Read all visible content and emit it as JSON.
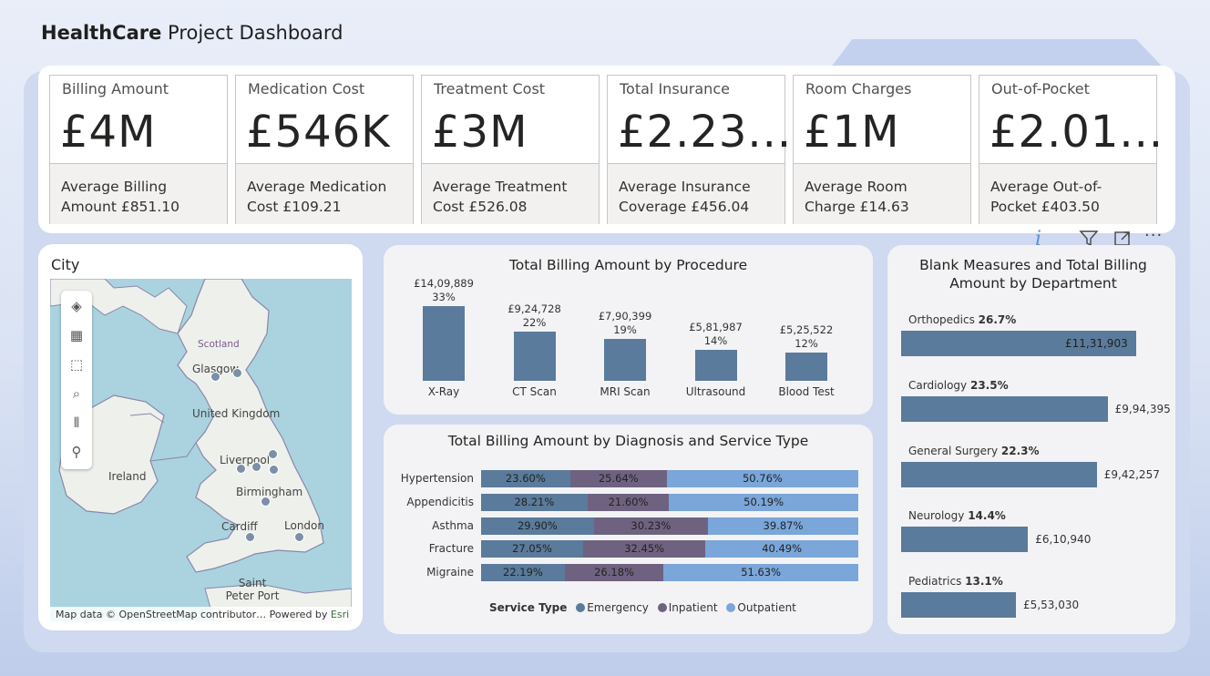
{
  "title": {
    "bold": "HealthCare",
    "rest": " Project Dashboard"
  },
  "kpis": [
    {
      "label": "Billing Amount",
      "value": "£4M",
      "foot": "Average Billing Amount £851.10"
    },
    {
      "label": "Medication Cost",
      "value": "£546K",
      "foot": "Average Medication Cost £109.21"
    },
    {
      "label": "Treatment Cost",
      "value": "£3M",
      "foot": "Average Treatment Cost £526.08"
    },
    {
      "label": "Total Insurance",
      "value": "£2.23...",
      "foot": "Average Insurance Coverage £456.04"
    },
    {
      "label": "Room Charges",
      "value": "£1M",
      "foot": "Average Room Charge £14.63"
    },
    {
      "label": "Out-of-Pocket",
      "value": "£2.01...",
      "foot": "Average Out-of-Pocket £403.50"
    }
  ],
  "visual_header": {
    "icons": [
      "info-icon",
      "filter-icon",
      "focus-mode-icon",
      "more-options-icon"
    ]
  },
  "map": {
    "title": "City",
    "labels": {
      "scotland": "Scotland",
      "glasgow": "Glasgow",
      "uk": "United Kingdom",
      "ireland": "Ireland",
      "liverpool": "Liverpool",
      "birmingham": "Birmingham",
      "cardiff": "Cardiff",
      "london": "London",
      "saint_peter_port": "Saint Peter Port"
    },
    "attribution": "Map data © OpenStreetMap contributor…",
    "powered_by": "Powered by ",
    "esri": "Esri",
    "tools": [
      "layers-icon",
      "qr-icon",
      "select-icon",
      "search-icon",
      "chart-icon",
      "person-icon"
    ]
  },
  "chart_data": [
    {
      "type": "bar",
      "title": "Total Billing Amount by Procedure",
      "categories": [
        "X-Ray",
        "CT Scan",
        "MRI Scan",
        "Ultrasound",
        "Blood Test"
      ],
      "values": [
        1409889,
        924728,
        790399,
        581987,
        525522
      ],
      "value_labels": [
        "£14,09,889",
        "£9,24,728",
        "£7,90,399",
        "£5,81,987",
        "£5,25,522"
      ],
      "percent_labels": [
        "33%",
        "22%",
        "19%",
        "14%",
        "12%"
      ],
      "color": "#5a7b9b"
    },
    {
      "type": "bar",
      "orientation": "horizontal-stacked-100",
      "title": "Total Billing Amount by Diagnosis and Service Type",
      "categories": [
        "Hypertension",
        "Appendicitis",
        "Asthma",
        "Fracture",
        "Migraine"
      ],
      "legend_title": "Service Type",
      "series": [
        {
          "name": "Emergency",
          "values": [
            23.6,
            28.21,
            29.9,
            27.05,
            22.19
          ],
          "labels": [
            "23.60%",
            "28.21%",
            "29.90%",
            "27.05%",
            "22.19%"
          ],
          "color": "#5a7b9b"
        },
        {
          "name": "Inpatient",
          "values": [
            25.64,
            21.6,
            30.23,
            32.45,
            26.18
          ],
          "labels": [
            "25.64%",
            "21.60%",
            "30.23%",
            "32.45%",
            "26.18%"
          ],
          "color": "#6f6280"
        },
        {
          "name": "Outpatient",
          "values": [
            50.76,
            50.19,
            39.87,
            40.49,
            51.63
          ],
          "labels": [
            "50.76%",
            "50.19%",
            "39.87%",
            "40.49%",
            "51.63%"
          ],
          "color": "#7aa6d9"
        }
      ]
    },
    {
      "type": "bar",
      "orientation": "horizontal",
      "title": "Blank Measures and Total Billing Amount by Department",
      "categories": [
        "Orthopedics",
        "Cardiology",
        "General Surgery",
        "Neurology",
        "Pediatrics"
      ],
      "percent_labels": [
        "26.7%",
        "23.5%",
        "22.3%",
        "14.4%",
        "13.1%"
      ],
      "values": [
        1131903,
        994395,
        942257,
        610940,
        553030
      ],
      "value_labels": [
        "£11,31,903",
        "£9,94,395",
        "£9,42,257",
        "£6,10,940",
        "£5,53,030"
      ],
      "color": "#5a7b9b"
    }
  ]
}
